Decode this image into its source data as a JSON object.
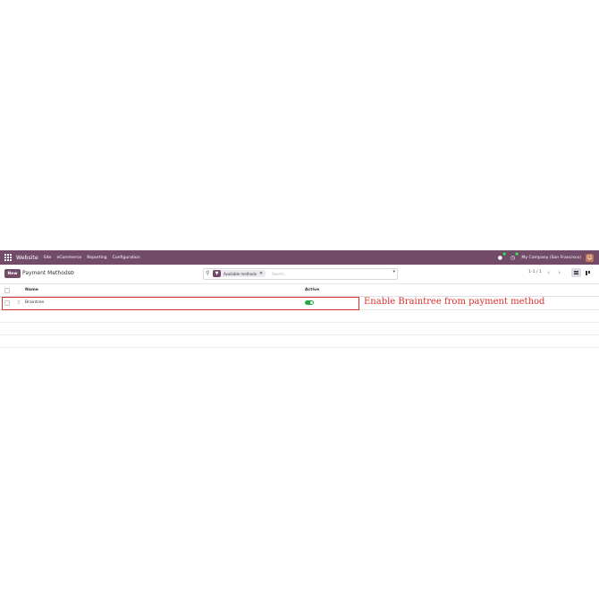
{
  "navbar": {
    "app_name": "Website",
    "menu": [
      "Site",
      "eCommerce",
      "Reporting",
      "Configuration"
    ],
    "company": "My Company (San Francisco)",
    "messages_badge": "5",
    "activity_badge": "8",
    "bg_color": "#714b67"
  },
  "control": {
    "new_label": "New",
    "title": "Payment Methods",
    "search": {
      "facet_label": "Available methods",
      "placeholder": "Search..."
    },
    "pager": "1-1 / 1"
  },
  "table": {
    "columns": [
      "Name",
      "Active"
    ],
    "rows": [
      {
        "name": "Braintree",
        "active": true
      }
    ]
  },
  "annotation": {
    "text": "Enable Braintree from payment method",
    "color": "#d9302c"
  }
}
